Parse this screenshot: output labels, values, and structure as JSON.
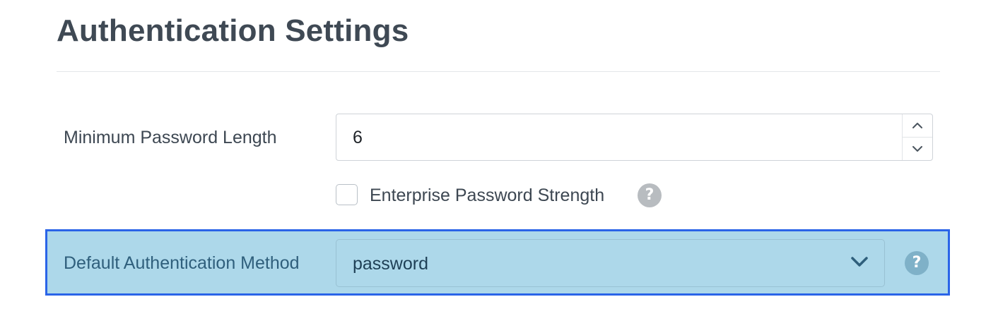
{
  "page": {
    "title": "Authentication Settings"
  },
  "min_password_length": {
    "label": "Minimum Password Length",
    "value": "6",
    "increment_icon": "chevron-up-icon",
    "decrement_icon": "chevron-down-icon"
  },
  "enterprise_strength": {
    "label": "Enterprise Password Strength",
    "checked": false,
    "help_icon": "question-circle-icon",
    "help_glyph": "?"
  },
  "default_auth_method": {
    "label": "Default Authentication Method",
    "selected": "password",
    "chevron_icon": "chevron-down-icon",
    "help_icon": "question-circle-icon",
    "help_glyph": "?",
    "highlighted": true
  },
  "colors": {
    "highlight_fill": "#add8ea",
    "highlight_border": "#2a64e8",
    "title_text": "#3f4954",
    "body_text": "#3d4752"
  }
}
